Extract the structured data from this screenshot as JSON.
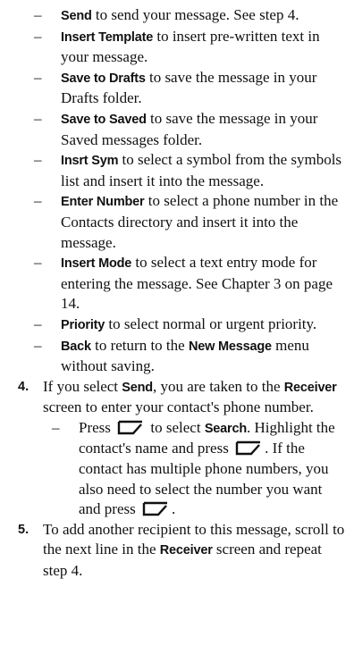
{
  "options": [
    {
      "label": "Send",
      "text": " to send your message. See step 4."
    },
    {
      "label": "Insert Template",
      "text": " to insert pre-written text in your message."
    },
    {
      "label": "Save to Drafts",
      "text": " to save the message in your Drafts folder."
    },
    {
      "label": "Save to Saved",
      "text": " to save the message in your Saved messages folder."
    },
    {
      "label": "Insrt Sym",
      "text": " to select a symbol from the symbols list and insert it into the message."
    },
    {
      "label": "Enter Number",
      "text": " to select a phone number in the Contacts directory and insert it into the message."
    },
    {
      "label": "Insert Mode",
      "text": " to select a text entry mode for entering the message. See Chapter 3 on page 14."
    },
    {
      "label": "Priority",
      "text": " to select normal or urgent priority."
    },
    {
      "label": "Back",
      "text": " to return to the ",
      "label2": "New Message",
      "text2": " menu without saving."
    }
  ],
  "step4": {
    "num": "4.",
    "t1": "If you select ",
    "b1": "Send",
    "t2": ", you are taken to the ",
    "b2": "Receiver",
    "t3": " screen to enter your contact's phone number.",
    "sub": {
      "t1": "Press ",
      "t2": " to select ",
      "b1": "Search",
      "t3": ". Highlight the contact's name and press ",
      "t4": ". If the contact has multiple phone numbers, you also need to select the number you want and press ",
      "t5": "."
    }
  },
  "step5": {
    "num": "5.",
    "t1": "To add another recipient to this message, scroll to the next line in the ",
    "b1": "Receiver",
    "t2": " screen and repeat step 4."
  },
  "icons": {
    "softkey": "left-softkey-icon"
  }
}
